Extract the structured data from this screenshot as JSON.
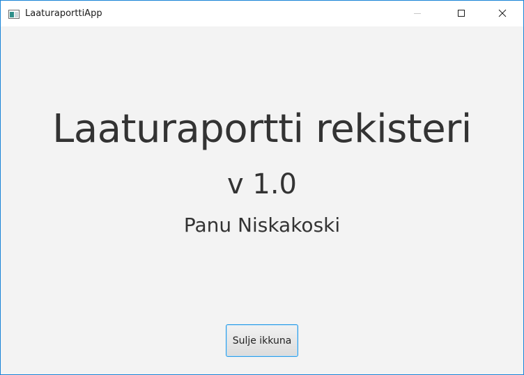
{
  "window": {
    "title": "LaaturaporttiApp",
    "icon": "app-window-icon",
    "controls": [
      "minimize-icon",
      "maximize-icon",
      "close-icon"
    ]
  },
  "main": {
    "title": "Laaturaportti rekisteri",
    "version": "v 1.0",
    "author": "Panu Niskakoski"
  },
  "actions": {
    "close_label": "Sulje ikkuna"
  },
  "colors": {
    "window_border": "#1883d7",
    "background": "#f3f3f3",
    "text": "#333333",
    "button_focus": "#2d9de6"
  }
}
